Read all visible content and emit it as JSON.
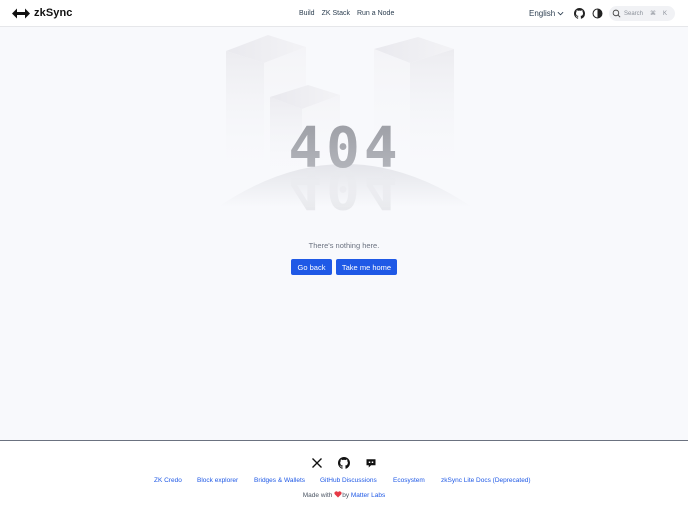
{
  "header": {
    "logo_text": "zkSync",
    "nav": [
      {
        "label": "Build"
      },
      {
        "label": "ZK Stack"
      },
      {
        "label": "Run a Node"
      }
    ],
    "language": "English",
    "search": {
      "placeholder": "Search",
      "shortcut_modifier": "⌘",
      "shortcut_key": "K"
    }
  },
  "main": {
    "error_code": "404",
    "message": "There's nothing here.",
    "buttons": {
      "back": "Go back",
      "home": "Take me home"
    },
    "accent_color": "#1f59e6"
  },
  "footer": {
    "social": [
      {
        "icon": "x-icon"
      },
      {
        "icon": "github-icon"
      },
      {
        "icon": "discord-icon"
      }
    ],
    "links": [
      {
        "label": "ZK Credo"
      },
      {
        "label": "Block explorer"
      },
      {
        "label": "Bridges & Wallets"
      },
      {
        "label": "GitHub Discussions"
      },
      {
        "label": "Ecosystem"
      },
      {
        "label": "zkSync Lite Docs (Deprecated)"
      }
    ],
    "made_with_prefix": "Made with",
    "made_with_by": "by",
    "made_with_org": "Matter Labs",
    "heart_color": "#e63946"
  }
}
